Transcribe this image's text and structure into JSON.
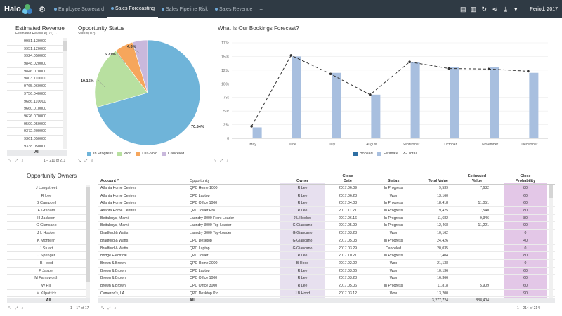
{
  "app": {
    "name": "Halo",
    "tabs": [
      {
        "label": "Employee Scorecard",
        "active": false
      },
      {
        "label": "Sales Forecasting",
        "active": true
      },
      {
        "label": "Sales Pipeline Risk",
        "active": false
      },
      {
        "label": "Sales Revenue",
        "active": false
      }
    ],
    "add_tab": "+",
    "period": "Period: 2017"
  },
  "revenue": {
    "title": "Estimated Revenue",
    "subtitle": "Estimated Revenue(1/1) ⌄",
    "items": [
      "9981.130000",
      "9951.120000",
      "9924.050000",
      "9848.020000",
      "9846.070000",
      "9803.110000",
      "9765.060000",
      "9756.040000",
      "9686.110000",
      "9660.010000",
      "9626.070000",
      "9590.050000",
      "9372.200000",
      "9361.050000",
      "9338.050000"
    ],
    "all_label": "All",
    "pager": "1 – 211 of 211"
  },
  "pie": {
    "title": "Opportunity Status",
    "subtitle": "Status(1/2)",
    "labels": [
      "70.54%",
      "19.15%",
      "5.71%",
      "4.6%"
    ],
    "legend": [
      "In Progress",
      "Won",
      "Out-Sold",
      "Canceled"
    ],
    "colors": [
      "#6fb4d9",
      "#b8e0a0",
      "#f6a65c",
      "#c9b8dc"
    ]
  },
  "chart_data": {
    "type": "bar",
    "title": "What Is Our Bookings Forecast?",
    "categories": [
      "May",
      "June",
      "July",
      "August",
      "September",
      "October",
      "November",
      "December"
    ],
    "ylim": [
      0,
      175000
    ],
    "yticks": [
      "0",
      "25k",
      "50k",
      "75k",
      "100k",
      "125k",
      "150k",
      "175k"
    ],
    "series": [
      {
        "name": "Estimate",
        "values": [
          20000,
          150000,
          120000,
          80000,
          140000,
          130000,
          130000,
          120000
        ]
      },
      {
        "name": "Total",
        "values": [
          22000,
          152000,
          118000,
          80000,
          140000,
          128000,
          127000,
          123000
        ]
      }
    ],
    "legend": [
      "Booked",
      "Estimate",
      "Total"
    ],
    "colors": {
      "booked": "#2f6fa3",
      "estimate": "#a8bfdf",
      "total": "#333333"
    }
  },
  "owners": {
    "title": "Opportunity Owners",
    "items": [
      "J Longstreet",
      "R Lee",
      "B Campbell",
      "F Graham",
      "H Jackson",
      "G Giancano",
      "J L Hooker",
      "K Montelth",
      "J Stuart",
      "J Springer",
      "B Hood",
      "P Jasper",
      "M Farnsworth",
      "W Hill",
      "M Kilpatrick"
    ],
    "all_label": "All",
    "pager": "1 – 17 of 17"
  },
  "table": {
    "headers": {
      "account": "Account ^",
      "opportunity": "Opportunity",
      "owner": "Owner",
      "close_date": "Close\nDate",
      "status": "Status",
      "total_value": "Total Value",
      "estimated_value": "Estimated\nValue",
      "close_probability": "Close\nProbability"
    },
    "rows": [
      [
        "Atlanta Home Centres",
        "QPC Home 1000",
        "R Lee",
        "2017.06.09",
        "In Progress",
        "9,539",
        "7,632",
        "80"
      ],
      [
        "Atlanta Home Centres",
        "QPC Laptop",
        "R Lee",
        "2017.06.28",
        "Won",
        "13,160",
        "",
        "60"
      ],
      [
        "Atlanta Home Centres",
        "QPC Office 1000",
        "R Lee",
        "2017.04.08",
        "In Progress",
        "18,418",
        "11,051",
        "60"
      ],
      [
        "Atlanta Home Centres",
        "QPC Tower Pro",
        "R Lee",
        "2017.11.21",
        "In Progress",
        "9,425",
        "7,540",
        "80"
      ],
      [
        "Bettabuys, Miami",
        "Laundry 3000 Front-Loader",
        "J L Hooker",
        "2017.06.16",
        "In Progress",
        "11,682",
        "9,346",
        "80"
      ],
      [
        "Bettabuys, Miami",
        "Laundry 3000 Top-Loader",
        "G Giancano",
        "2017.05.09",
        "In Progress",
        "12,468",
        "11,221",
        "90"
      ],
      [
        "Bradford & Watts",
        "Laundry 3000 Top-Loader",
        "G Giancano",
        "2017.03.28",
        "Won",
        "10,162",
        "",
        "0"
      ],
      [
        "Bradford & Watts",
        "QPC Desktop",
        "G Giancano",
        "2017.05.03",
        "In Progress",
        "24,426",
        "",
        "40"
      ],
      [
        "Bradford & Watts",
        "QPC Laptop",
        "G Giancano",
        "2017.03.29",
        "Canceled",
        "20,035",
        "",
        "0"
      ],
      [
        "Bridge Electrical",
        "QPC Tower",
        "R Lee",
        "2017.10.21",
        "In Progress",
        "17,404",
        "",
        "80"
      ],
      [
        "Brown & Brown",
        "QPC Home 2000",
        "B Hood",
        "2017.02.02",
        "Won",
        "21,138",
        "",
        "0"
      ],
      [
        "Brown & Brown",
        "QPC Laptop",
        "R Lee",
        "2017.03.06",
        "Won",
        "10,136",
        "",
        "60"
      ],
      [
        "Brown & Brown",
        "QPC Office 1000",
        "R Lee",
        "2017.03.28",
        "Won",
        "16,366",
        "",
        "60"
      ],
      [
        "Brown & Brown",
        "QPC Office 3000",
        "R Lee",
        "2017.05.06",
        "In Progress",
        "11,818",
        "5,909",
        "60"
      ],
      [
        "Cameron's, LA",
        "QPC Desktop Pro",
        "J B Hood",
        "2017.03.12",
        "Won",
        "13,200",
        "",
        "90"
      ]
    ],
    "all_label": "All",
    "total_value": "3,277,724",
    "total_estimated": "888,404",
    "pager": "1 – 214 of 214"
  }
}
